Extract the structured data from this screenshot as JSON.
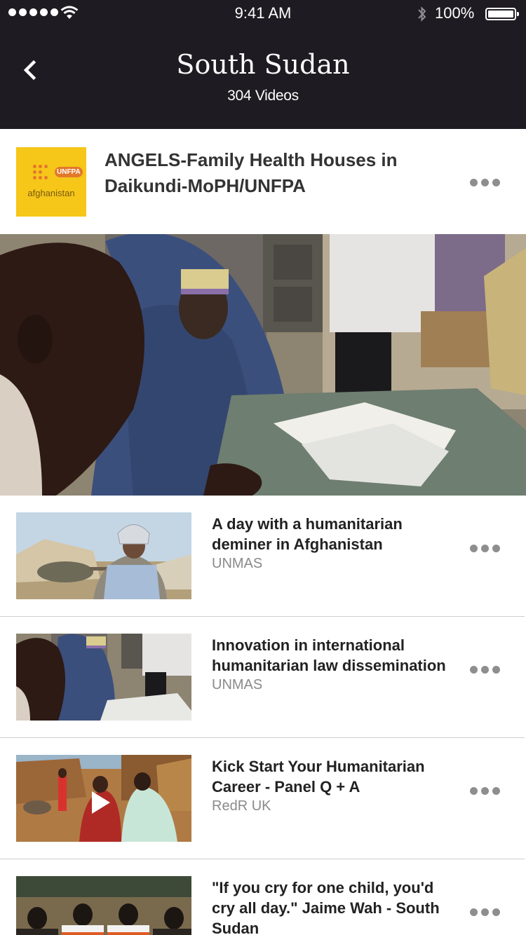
{
  "status_bar": {
    "time": "9:41 AM",
    "battery": "100%"
  },
  "header": {
    "title": "South Sudan",
    "subtitle": "304 Videos",
    "back_icon": "chevron-left-icon"
  },
  "featured": {
    "title": "ANGELS-Family Health Houses in Daikundi-MoPH/UNFPA",
    "thumb_logo": "UNFPA",
    "thumb_caption": "afghanistan"
  },
  "videos": [
    {
      "title": "A day with a humanitarian deminer in Afghanistan",
      "author": "UNMAS"
    },
    {
      "title": "Innovation in international humanitarian law dissemination",
      "author": "UNMAS"
    },
    {
      "title": "Kick Start Your Humanitarian Career - Panel Q + A",
      "author": "RedR UK"
    },
    {
      "title": "\"If you cry for one child, you'd cry all day.\" Jaime Wah - South Sudan",
      "author": ""
    }
  ],
  "colors": {
    "header_bg": "#1f1b22",
    "accent_yellow": "#f6c619",
    "muted_text": "#8a8a8a"
  }
}
